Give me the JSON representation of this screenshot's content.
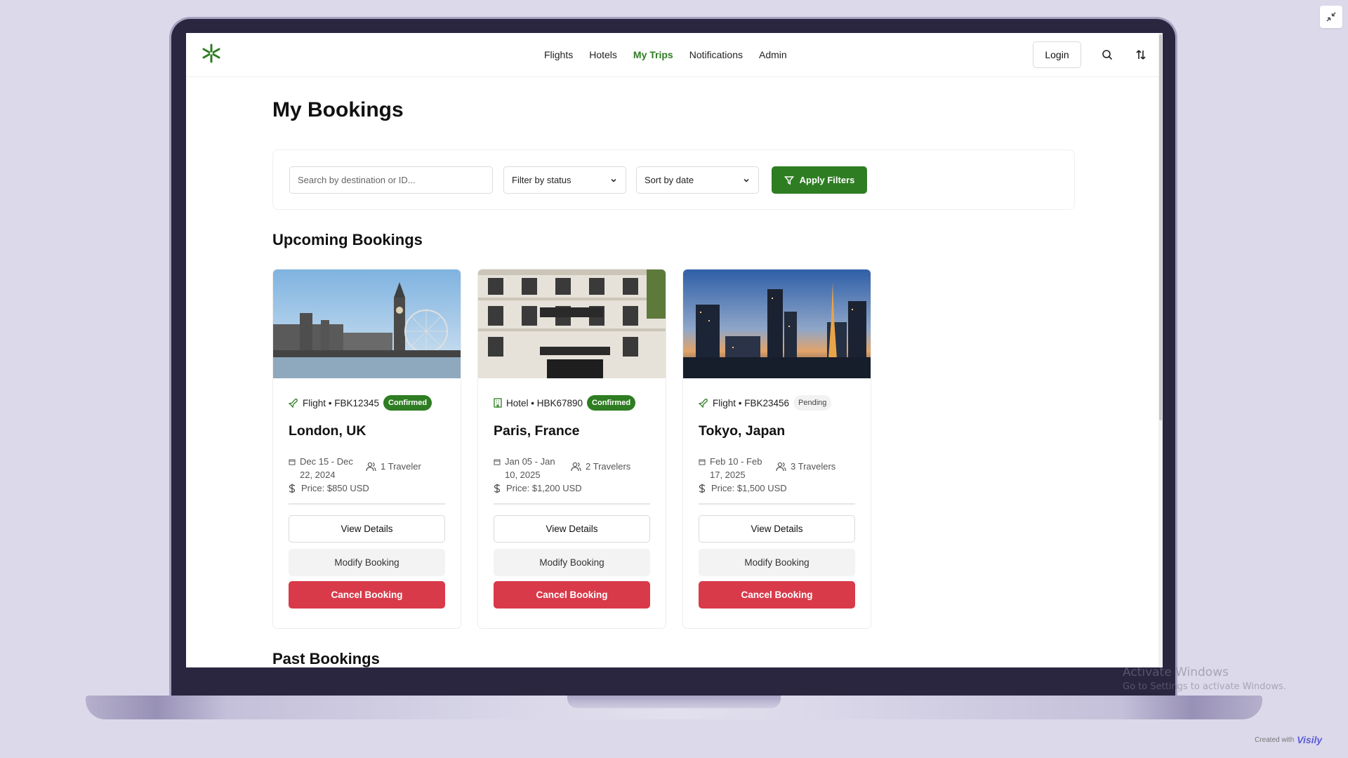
{
  "nav": {
    "links": [
      "Flights",
      "Hotels",
      "My Trips",
      "Notifications",
      "Admin"
    ],
    "active": "My Trips",
    "login_label": "Login"
  },
  "page": {
    "title": "My Bookings"
  },
  "filters": {
    "search_placeholder": "Search by destination or ID...",
    "status_label": "Filter by status",
    "sort_label": "Sort by date",
    "apply_label": "Apply Filters"
  },
  "sections": {
    "upcoming": "Upcoming Bookings",
    "past": "Past Bookings"
  },
  "bookings": [
    {
      "type": "Flight",
      "id": "FBK12345",
      "meta": "Flight • FBK12345",
      "status": "Confirmed",
      "title": "London, UK",
      "dates": "Dec 15 - Dec 22, 2024",
      "travelers": "1 Traveler",
      "price": "Price: $850 USD",
      "view": "View Details",
      "modify": "Modify Booking",
      "cancel": "Cancel Booking"
    },
    {
      "type": "Hotel",
      "id": "HBK67890",
      "meta": "Hotel • HBK67890",
      "status": "Confirmed",
      "title": "Paris, France",
      "dates": "Jan 05 - Jan 10, 2025",
      "travelers": "2 Travelers",
      "price": "Price: $1,200 USD",
      "view": "View Details",
      "modify": "Modify Booking",
      "cancel": "Cancel Booking"
    },
    {
      "type": "Flight",
      "id": "FBK23456",
      "meta": "Flight • FBK23456",
      "status": "Pending",
      "title": "Tokyo, Japan",
      "dates": "Feb 10 - Feb 17, 2025",
      "travelers": "3 Travelers",
      "price": "Price: $1,500 USD",
      "view": "View Details",
      "modify": "Modify Booking",
      "cancel": "Cancel Booking"
    }
  ],
  "watermark": {
    "title": "Activate Windows",
    "subtitle": "Go to Settings to activate Windows."
  },
  "footer": {
    "created_with": "Created with",
    "brand": "Visily"
  },
  "colors": {
    "brand_green": "#2e7d22",
    "danger": "#d93a4a",
    "frame": "#2a2640",
    "background": "#dcdaea"
  },
  "icons": [
    "logo-icon",
    "search-icon",
    "sort-icon",
    "chevron-down-icon",
    "filter-icon",
    "plane-icon",
    "hotel-icon",
    "calendar-icon",
    "users-icon",
    "dollar-icon",
    "collapse-icon"
  ]
}
